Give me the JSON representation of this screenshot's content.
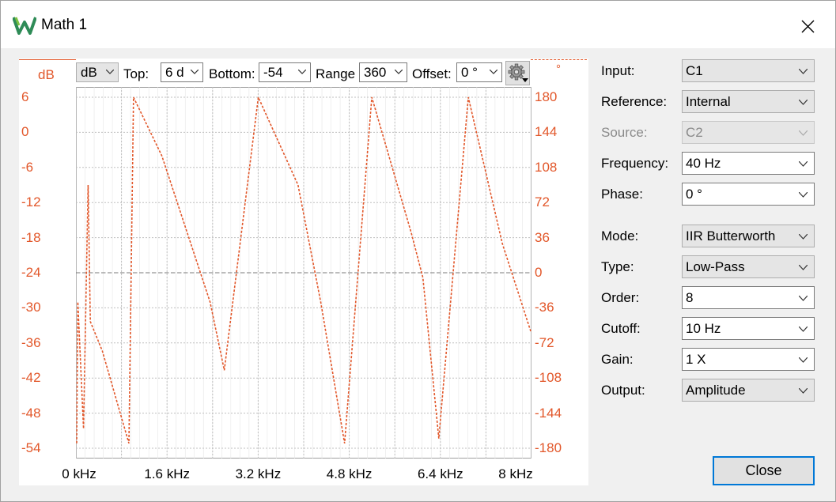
{
  "window": {
    "title": "Math 1"
  },
  "toolbar": {
    "left_unit": "dB",
    "unit_combo": "dB",
    "top_label": "Top:",
    "top_value": "6 d",
    "bottom_label": "Bottom:",
    "bottom_value": "-54",
    "range_label": "Range",
    "range_value": "360",
    "offset_label": "Offset:",
    "offset_value": "0 °",
    "right_unit": "°"
  },
  "colors": {
    "trace": "#e2572a",
    "focus": "#0078d7"
  },
  "icons": {
    "app": "waveforms-logo-icon",
    "close": "close-icon",
    "settings": "gear-icon",
    "dropdown": "chevron-down-icon"
  },
  "chart_data": {
    "type": "line",
    "y_left_ticks": [
      "6",
      "0",
      "-6",
      "-12",
      "-18",
      "-24",
      "-30",
      "-36",
      "-42",
      "-48",
      "-54"
    ],
    "y_right_ticks": [
      "180",
      "144",
      "108",
      "72",
      "36",
      "0",
      "-36",
      "-72",
      "-108",
      "-144",
      "-180"
    ],
    "x_ticks": [
      "0 kHz",
      "1.6 kHz",
      "3.2 kHz",
      "4.8 kHz",
      "6.4 kHz",
      "8 kHz"
    ],
    "ylim_left": [
      -54,
      6
    ],
    "ylim_right": [
      -180,
      180
    ],
    "xlim_khz": [
      0,
      8
    ],
    "grid": true,
    "series": [
      {
        "axis": "right",
        "style": "dashed",
        "x": [
          0,
          0.02,
          0.12,
          0.2,
          0.24,
          0.45,
          0.92,
          1.0,
          1.5,
          2.35,
          2.6,
          3.2,
          3.9,
          4.3,
          4.72,
          5.2,
          5.9,
          6.1,
          6.38,
          6.9,
          7.5,
          8.0
        ],
        "y": [
          -175,
          -30,
          -160,
          90,
          -50,
          -80,
          -175,
          180,
          120,
          -30,
          -100,
          180,
          90,
          -30,
          -175,
          180,
          40,
          -5,
          -170,
          180,
          30,
          -60
        ]
      }
    ]
  },
  "settings": {
    "input_label": "Input:",
    "input_value": "C1",
    "reference_label": "Reference:",
    "reference_value": "Internal",
    "source_label": "Source:",
    "source_value": "C2",
    "frequency_label": "Frequency:",
    "frequency_value": "40 Hz",
    "phase_label": "Phase:",
    "phase_value": "0 °",
    "mode_label": "Mode:",
    "mode_value": "IIR Butterworth",
    "type_label": "Type:",
    "type_value": "Low-Pass",
    "order_label": "Order:",
    "order_value": "8",
    "cutoff_label": "Cutoff:",
    "cutoff_value": "10 Hz",
    "gain_label": "Gain:",
    "gain_value": "1 X",
    "output_label": "Output:",
    "output_value": "Amplitude"
  },
  "footer": {
    "close_label": "Close"
  }
}
